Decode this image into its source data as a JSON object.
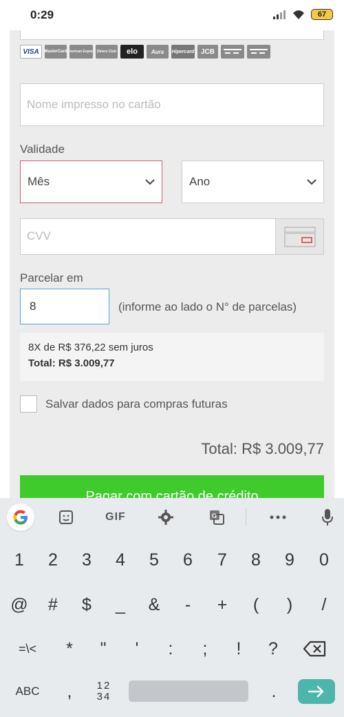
{
  "status_bar": {
    "time": "0:29",
    "battery": "67"
  },
  "card_brands": [
    "VISA",
    "MasterCard",
    "American Express",
    "Diners Club",
    "elo",
    "Aura",
    "Hipercard",
    "JCB",
    "card",
    "card"
  ],
  "form": {
    "name_placeholder": "Nome impresso no cartão",
    "validade_label": "Validade",
    "month_select": "Mês",
    "year_select": "Ano",
    "cvv_placeholder": "CVV",
    "parcelar_label": "Parcelar em",
    "parcelas_value": "8",
    "parcelas_hint": "(informe ao lado o N° de parcelas)",
    "summary_line": "8X de R$ 376,22 sem juros",
    "summary_total": "Total: R$ 3.009,77",
    "save_label": "Salvar dados para compras futuras",
    "total": "Total: R$ 3.009,77",
    "pay_button": "Pagar com cartão de crédito"
  },
  "keyboard": {
    "toolbar": {
      "gif": "GIF"
    },
    "row1": [
      "1",
      "2",
      "3",
      "4",
      "5",
      "6",
      "7",
      "8",
      "9",
      "0"
    ],
    "row2": [
      "@",
      "#",
      "$",
      "_",
      "&",
      "-",
      "+",
      "(",
      ")",
      "/"
    ],
    "row3": [
      "=\\<",
      "*",
      "\"",
      "'",
      ":",
      ";",
      "!",
      "?"
    ],
    "row4": {
      "abc": "ABC",
      "comma": ",",
      "numbers_top": "12",
      "numbers_bottom": "34",
      "period": "."
    }
  },
  "colors": {
    "pay_green": "#3fcb2b",
    "error_border": "#d85a6a",
    "focus_border": "#4aa8d8",
    "enter_key": "#4db6ac"
  }
}
